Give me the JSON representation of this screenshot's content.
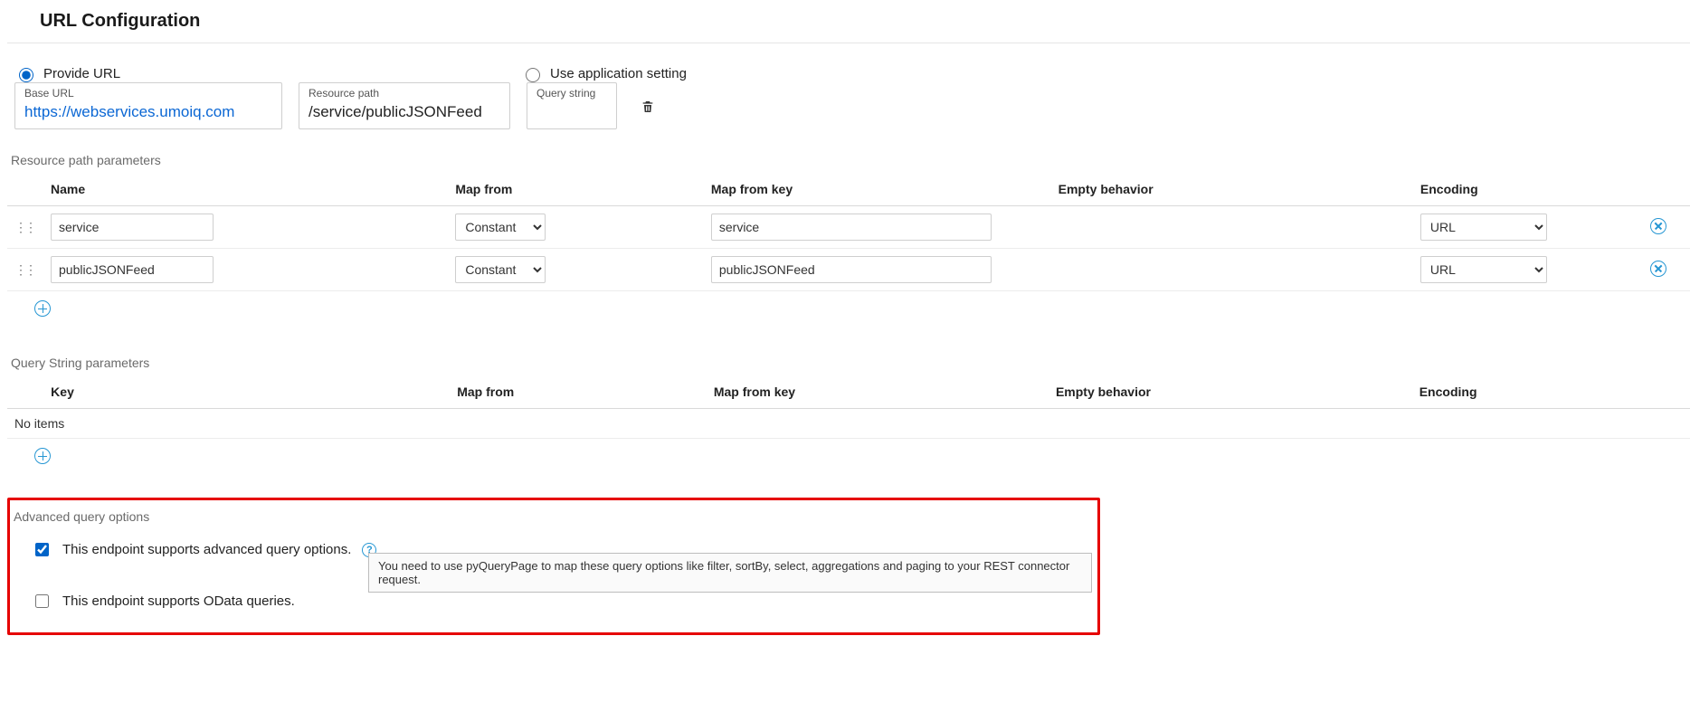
{
  "page_title": "URL Configuration",
  "url_mode": {
    "provide_label": "Provide URL",
    "use_setting_label": "Use application setting",
    "selected": "provide"
  },
  "fields": {
    "base_url": {
      "label": "Base URL",
      "value": "https://webservices.umoiq.com"
    },
    "resource_path": {
      "label": "Resource path",
      "value": "/service/publicJSONFeed"
    },
    "query_string": {
      "label": "Query string",
      "value": ""
    }
  },
  "resource_params": {
    "section_label": "Resource path parameters",
    "headers": {
      "name": "Name",
      "map_from": "Map from",
      "map_from_key": "Map from key",
      "empty_behavior": "Empty behavior",
      "encoding": "Encoding"
    },
    "rows": [
      {
        "name": "service",
        "map_from": "Constant",
        "map_from_key": "service",
        "empty_behavior": "",
        "encoding": "URL"
      },
      {
        "name": "publicJSONFeed",
        "map_from": "Constant",
        "map_from_key": "publicJSONFeed",
        "empty_behavior": "",
        "encoding": "URL"
      }
    ]
  },
  "query_params": {
    "section_label": "Query String parameters",
    "headers": {
      "key": "Key",
      "map_from": "Map from",
      "map_from_key": "Map from key",
      "empty_behavior": "Empty behavior",
      "encoding": "Encoding"
    },
    "no_items_label": "No items"
  },
  "advanced": {
    "section_label": "Advanced query options",
    "advanced_checkbox_label": "This endpoint supports advanced query options.",
    "advanced_checked": true,
    "odata_checkbox_label": "This endpoint supports OData queries.",
    "odata_checked": false,
    "tooltip": "You need to use pyQueryPage to map these query options like filter, sortBy, select, aggregations and paging to your REST connector request."
  },
  "select_options": {
    "map_from": [
      "Constant"
    ],
    "encoding": [
      "URL"
    ]
  }
}
